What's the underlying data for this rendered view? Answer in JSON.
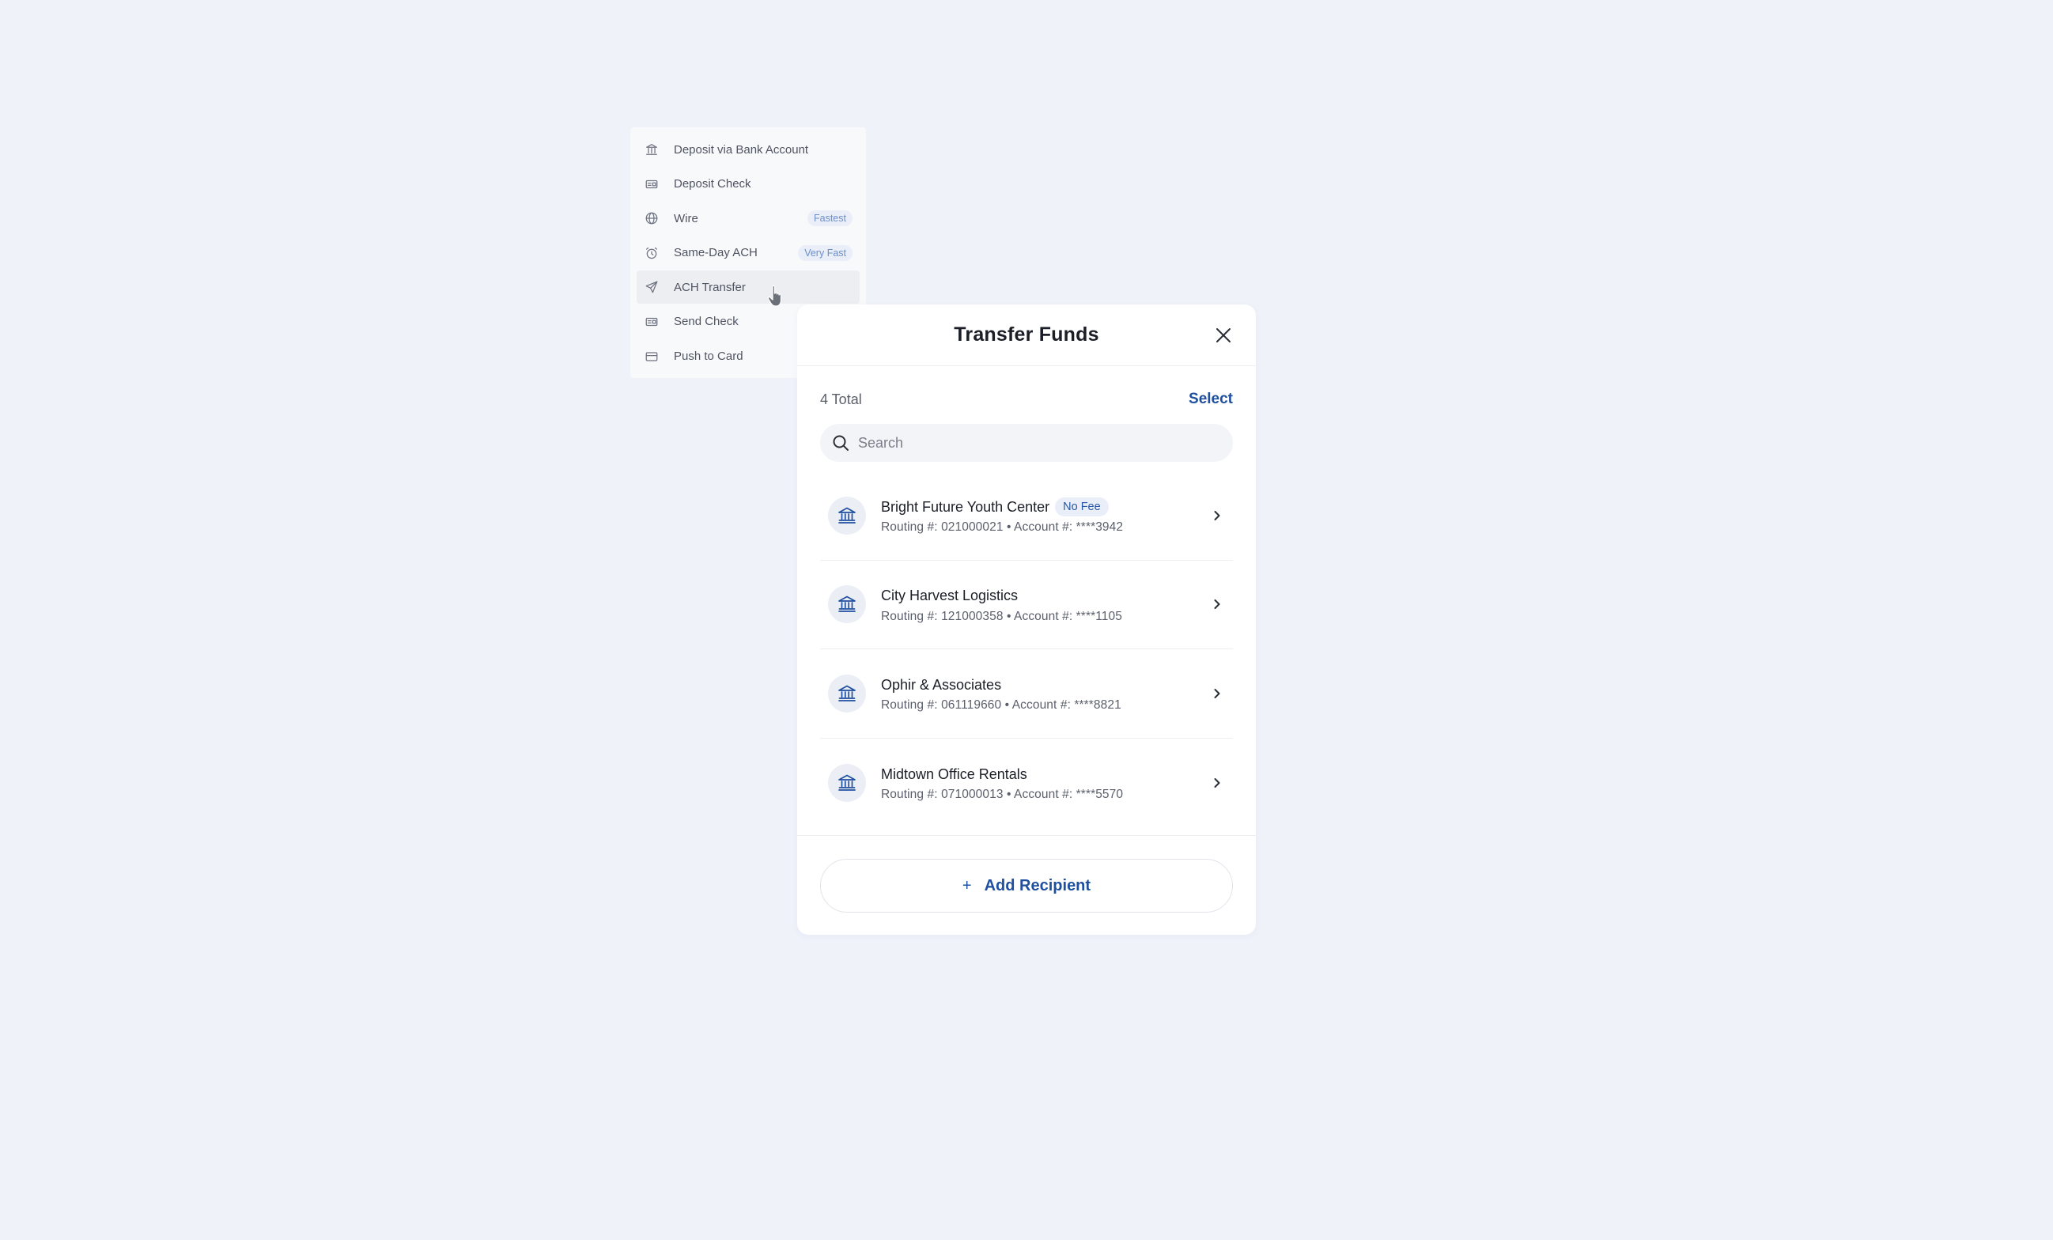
{
  "menu": {
    "items": [
      {
        "label": "Deposit via Bank Account",
        "icon": "bank-icon"
      },
      {
        "label": "Deposit Check",
        "icon": "check-icon"
      },
      {
        "label": "Wire",
        "icon": "globe-icon",
        "badge": "Fastest"
      },
      {
        "label": "Same-Day ACH",
        "icon": "alarm-clock-icon",
        "badge": "Very Fast"
      },
      {
        "label": "ACH Transfer",
        "icon": "paper-plane-icon",
        "active": true
      },
      {
        "label": "Send Check",
        "icon": "check-icon"
      },
      {
        "label": "Push to Card",
        "icon": "credit-card-icon"
      }
    ]
  },
  "modal": {
    "title": "Transfer Funds",
    "total": "4 Total",
    "select_label": "Select",
    "search": {
      "placeholder": "Search",
      "value": ""
    },
    "recipients": [
      {
        "name": "Bright Future Youth Center",
        "badge": "No Fee",
        "meta": "Routing #: 021000021 • Account #: ****3942"
      },
      {
        "name": "City Harvest Logistics",
        "meta": "Routing #: 121000358 • Account #: ****1105"
      },
      {
        "name": "Ophir & Associates",
        "meta": "Routing #: 061119660 • Account #: ****8821"
      },
      {
        "name": "Midtown Office Rentals",
        "meta": "Routing #: 071000013 • Account #: ****5570"
      }
    ],
    "add_plus": "+",
    "add_label": "Add Recipient"
  },
  "colors": {
    "background": "#f0f2fa",
    "accent": "#1f4f9f",
    "badge_text": "#6d8fc7"
  }
}
